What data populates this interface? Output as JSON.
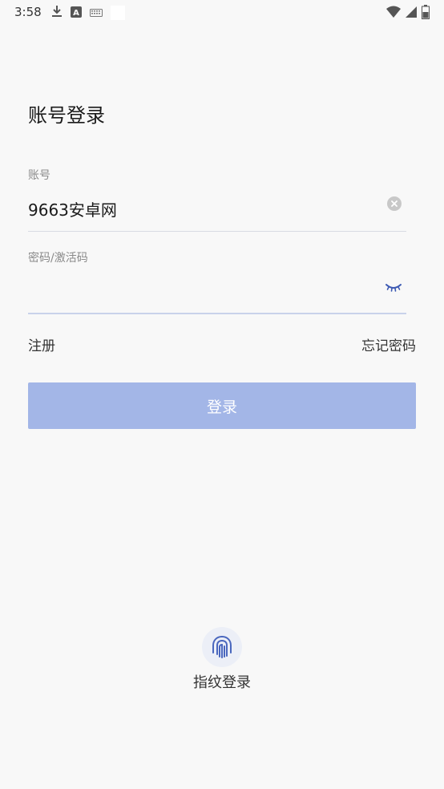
{
  "status_bar": {
    "time": "3:58",
    "icons_left": [
      "download-icon",
      "a-box-icon",
      "keyboard-icon"
    ],
    "icons_right": [
      "wifi-icon",
      "signal-icon",
      "battery-icon"
    ]
  },
  "page": {
    "title": "账号登录"
  },
  "form": {
    "account_label": "账号",
    "account_value": "9663安卓网",
    "password_label": "密码/激活码",
    "password_value": "",
    "register_link": "注册",
    "forgot_link": "忘记密码",
    "login_button": "登录"
  },
  "fingerprint": {
    "label": "指纹登录",
    "icon": "fingerprint-icon"
  },
  "colors": {
    "background": "#f8f8f8",
    "primary_button": "#a3b6e7",
    "accent_icon": "#3d5ab3"
  }
}
